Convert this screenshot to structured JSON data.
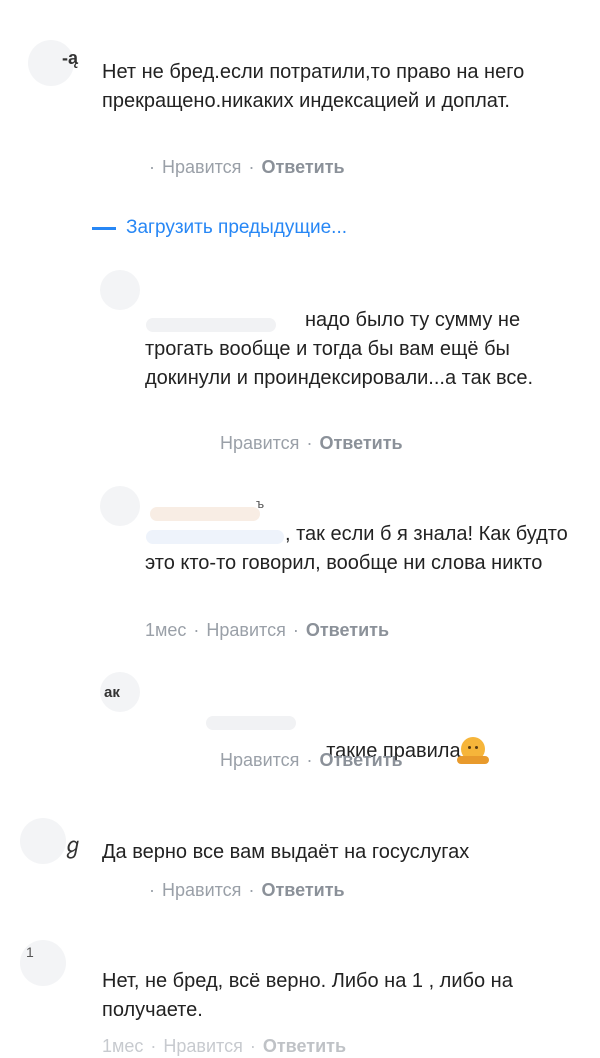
{
  "thread": {
    "load_previous_label": "Загрузить предыдущие...",
    "like_label": "Нравится",
    "reply_label": "Ответить",
    "separator": "·",
    "comments": [
      {
        "name_fragment": "-ą",
        "text": "Нет не бред.если потратили,то право на него прекращено.никаких индексацией и доплат.",
        "time": "",
        "is_reply": false
      },
      {
        "name_fragment": "",
        "text": "надо было ту сумму не трогать вообще и тогда бы вам ещё бы докинули и проиндексировали...а так все.",
        "time": "",
        "is_reply": true
      },
      {
        "name_fragment": "ъ",
        "text": ", так если б я знала! Как будто это кто-то говорил, вообще ни слова никто",
        "time": "1мес",
        "is_reply": true
      },
      {
        "name_fragment": "ак",
        "text": "такие правила",
        "emoji": "person-shrugging-emoji",
        "time": "",
        "is_reply": true
      },
      {
        "name_fragment": "",
        "text": "Да верно все вам выдаёт на госуслугах",
        "time": "",
        "is_reply": false
      },
      {
        "name_fragment": "1",
        "text": "Нет, не бред, всё верно. Либо на 1 , либо на получаете.",
        "time": "1мес",
        "is_reply": false
      }
    ]
  },
  "colors": {
    "link_blue": "#2787f5",
    "meta_gray": "#9aa0a8",
    "text_dark": "#222222",
    "background": "#ffffff"
  }
}
